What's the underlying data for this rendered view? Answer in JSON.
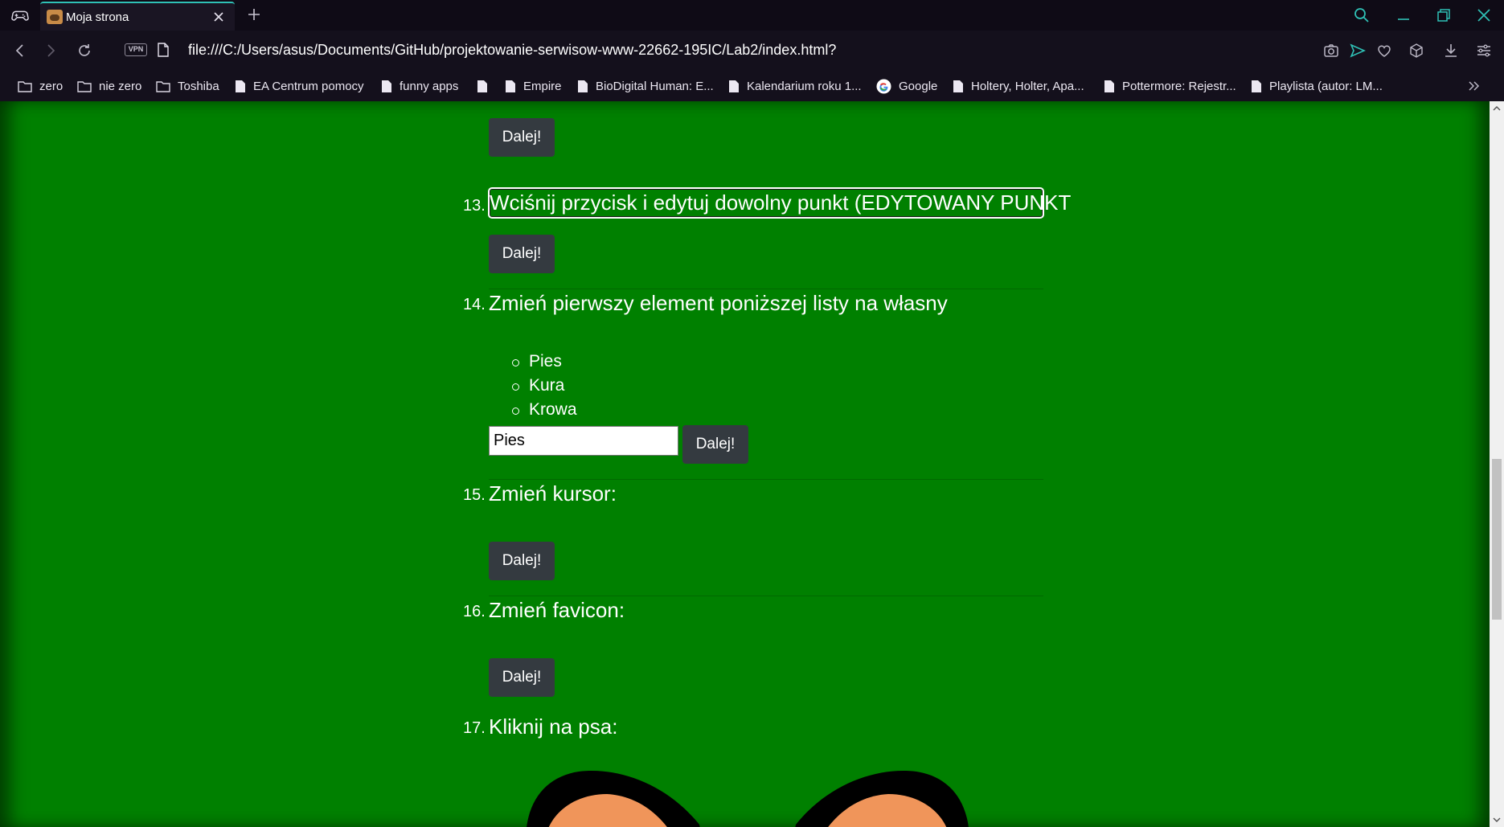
{
  "browser": {
    "tab": {
      "title": "Moja strona"
    },
    "address": {
      "vpn_label": "VPN",
      "url": "file:///C:/Users/asus/Documents/GitHub/projektowanie-serwisow-www-22662-195IC/Lab2/index.html?"
    },
    "bookmarks": [
      {
        "label": "zero",
        "icon": "folder-icon"
      },
      {
        "label": "nie zero",
        "icon": "folder-icon"
      },
      {
        "label": "Toshiba",
        "icon": "folder-icon"
      },
      {
        "label": "EA Centrum pomocy",
        "icon": "page-icon"
      },
      {
        "label": "funny apps",
        "icon": "page-icon"
      },
      {
        "label": "",
        "icon": "page-icon"
      },
      {
        "label": "Empire",
        "icon": "page-icon"
      },
      {
        "label": "BioDigital Human: E...",
        "icon": "page-icon"
      },
      {
        "label": "Kalendarium roku 1...",
        "icon": "page-icon"
      },
      {
        "label": "Google",
        "icon": "google-icon"
      },
      {
        "label": "Holtery, Holter, Apa...",
        "icon": "page-icon"
      },
      {
        "label": "Pottermore: Rejestr...",
        "icon": "page-icon"
      },
      {
        "label": "Playlista (autor: LM...",
        "icon": "page-icon"
      }
    ]
  },
  "page": {
    "button_label": "Dalej!",
    "items": [
      {
        "number": "13.",
        "text": "Wciśnij przycisk i edytuj dowolny punkt (EDYTOWANY PUNKT"
      },
      {
        "number": "14.",
        "text": "Zmień pierwszy element poniższej listy na własny",
        "list": [
          "Pies",
          "Kura",
          "Krowa"
        ],
        "input_value": "Pies"
      },
      {
        "number": "15.",
        "text": "Zmień kursor:"
      },
      {
        "number": "16.",
        "text": "Zmień favicon:"
      },
      {
        "number": "17.",
        "text": "Kliknij na psa:"
      }
    ]
  },
  "colors": {
    "page_background": "#008000",
    "button_background": "#343a40",
    "tab_accent": "#2fc1b6"
  }
}
